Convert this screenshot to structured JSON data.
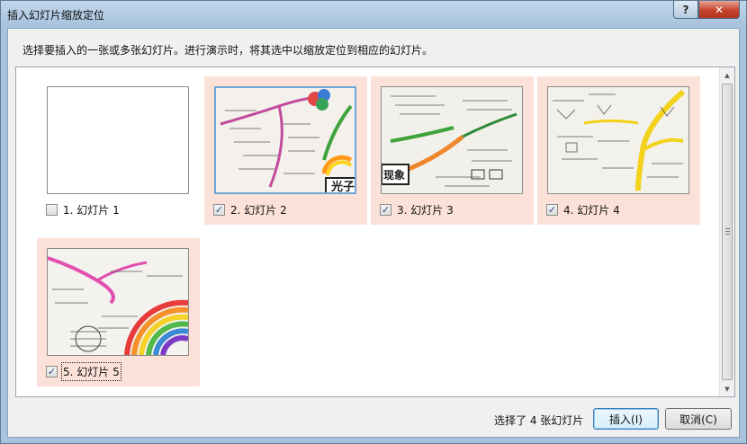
{
  "window": {
    "title": "插入幻灯片缩放定位",
    "help_label": "?",
    "close_label": "✕"
  },
  "instruction": "选择要插入的一张或多张幻灯片。进行演示时，将其选中以缩放定位到相应的幻灯片。",
  "slides": [
    {
      "label": "1. 幻灯片 1",
      "checked": false,
      "check_mark": ""
    },
    {
      "label": "2. 幻灯片 2",
      "checked": true,
      "check_mark": "✓",
      "thumb_text": "光子"
    },
    {
      "label": "3. 幻灯片 3",
      "checked": true,
      "check_mark": "✓",
      "thumb_text": "现象"
    },
    {
      "label": "4. 幻灯片 4",
      "checked": true,
      "check_mark": "✓"
    },
    {
      "label": "5. 幻灯片 5",
      "checked": true,
      "check_mark": "✓"
    }
  ],
  "scrollbar": {
    "up_icon": "▲",
    "down_icon": "▼"
  },
  "footer": {
    "status": "选择了 4 张幻灯片",
    "insert_label": "插入(I)",
    "cancel_label": "取消(C)"
  },
  "colors": {
    "selected_tile": "#fbe1d8",
    "title_bar": "#b4cce4",
    "close_button": "#c4432c"
  }
}
